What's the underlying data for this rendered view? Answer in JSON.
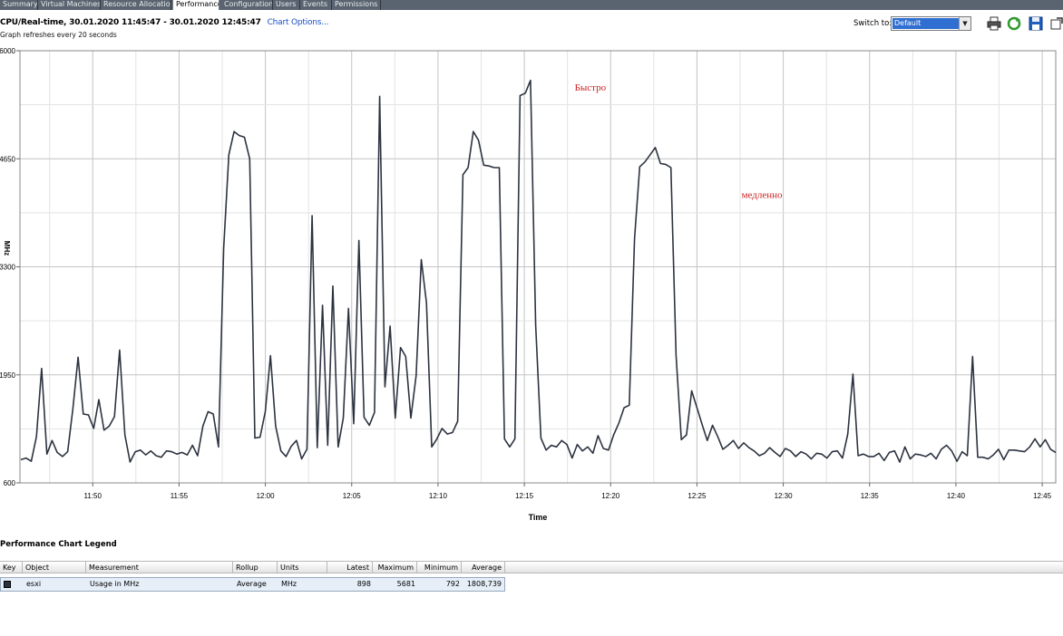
{
  "tabs": [
    {
      "label": "Summary",
      "active": false
    },
    {
      "label": "Virtual Machines",
      "active": false
    },
    {
      "label": "Resource Allocation",
      "active": false
    },
    {
      "label": "Performance",
      "active": true
    },
    {
      "label": "Configuration",
      "active": false
    },
    {
      "label": "Users",
      "active": false
    },
    {
      "label": "Events",
      "active": false
    },
    {
      "label": "Permissions",
      "active": false
    }
  ],
  "header": {
    "title": "CPU/Real-time, 30.01.2020 11:45:47 - 30.01.2020 12:45:47",
    "chart_options": "Chart Options...",
    "subtitle": "Graph refreshes every 20 seconds",
    "switch_label": "Switch to:",
    "switch_value": "Default"
  },
  "toolbar_icons": [
    "printer-icon",
    "refresh-icon",
    "save-icon",
    "popout-icon"
  ],
  "colors": {
    "line": "#2c3340",
    "grid": "#c8c8c8",
    "annotation": "#cc2222",
    "selection": "#2f6fd1"
  },
  "chart_data": {
    "type": "line",
    "xlabel": "Time",
    "ylabel": "MHz",
    "ylim": [
      600,
      6000
    ],
    "yticks": [
      600,
      1950,
      3300,
      4650,
      6000
    ],
    "xlim": [
      "11:45:47",
      "12:45:47"
    ],
    "xticks": [
      "11:50",
      "11:55",
      "12:00",
      "12:05",
      "12:10",
      "12:15",
      "12:20",
      "12:25",
      "12:30",
      "12:35",
      "12:40",
      "12:45"
    ],
    "grid": true,
    "annotations": [
      {
        "text": "Быстро",
        "x": "12:17:55",
        "y": 5500
      },
      {
        "text": "медленно",
        "x": "12:27:35",
        "y": 4160
      }
    ],
    "series": [
      {
        "name": "esxi",
        "values": [
          890,
          910,
          870,
          1180,
          2030,
          960,
          1130,
          980,
          930,
          990,
          1520,
          2170,
          1460,
          1450,
          1280,
          1640,
          1260,
          1310,
          1430,
          2260,
          1200,
          860,
          990,
          1010,
          950,
          1000,
          940,
          920,
          1000,
          990,
          960,
          980,
          950,
          1070,
          940,
          1310,
          1490,
          1460,
          1050,
          3530,
          4700,
          4990,
          4940,
          4920,
          4650,
          1160,
          1170,
          1490,
          2190,
          1310,
          1000,
          930,
          1060,
          1130,
          900,
          1020,
          3940,
          1040,
          2820,
          1070,
          3060,
          1050,
          1410,
          2780,
          1340,
          3630,
          1420,
          1320,
          1480,
          5430,
          1800,
          2560,
          1410,
          2290,
          2180,
          1410,
          1940,
          3390,
          2850,
          1050,
          1150,
          1280,
          1210,
          1230,
          1370,
          4450,
          4540,
          4990,
          4880,
          4570,
          4560,
          4540,
          4540,
          1150,
          1050,
          1150,
          5440,
          5470,
          5630,
          2570,
          1160,
          1010,
          1070,
          1050,
          1130,
          1080,
          910,
          1080,
          1000,
          1050,
          970,
          1190,
          1030,
          1010,
          1200,
          1350,
          1540,
          1570,
          3650,
          4550,
          4610,
          4700,
          4790,
          4590,
          4580,
          4540,
          2190,
          1140,
          1200,
          1750,
          1540,
          1330,
          1130,
          1320,
          1180,
          1020,
          1070,
          1130,
          1030,
          1100,
          1040,
          1000,
          940,
          970,
          1040,
          980,
          930,
          1030,
          1000,
          930,
          990,
          960,
          900,
          970,
          960,
          910,
          990,
          1000,
          910,
          1210,
          1960,
          940,
          960,
          930,
          930,
          970,
          880,
          980,
          1000,
          860,
          1050,
          900,
          960,
          950,
          930,
          970,
          900,
          1020,
          1070,
          1000,
          870,
          990,
          940,
          2180,
          920,
          920,
          900,
          950,
          1020,
          890,
          1010,
          1010,
          1000,
          990,
          1050,
          1150,
          1050,
          1140,
          1020,
          980
        ]
      }
    ]
  },
  "legend": {
    "title": "Performance Chart Legend",
    "columns": [
      "Key",
      "Object",
      "Measurement",
      "Rollup",
      "Units",
      "Latest",
      "Maximum",
      "Minimum",
      "Average"
    ],
    "row": {
      "object": "esxi",
      "measurement": "Usage in MHz",
      "rollup": "Average",
      "units": "MHz",
      "latest": "898",
      "maximum": "5681",
      "minimum": "792",
      "average": "1808,739"
    }
  }
}
